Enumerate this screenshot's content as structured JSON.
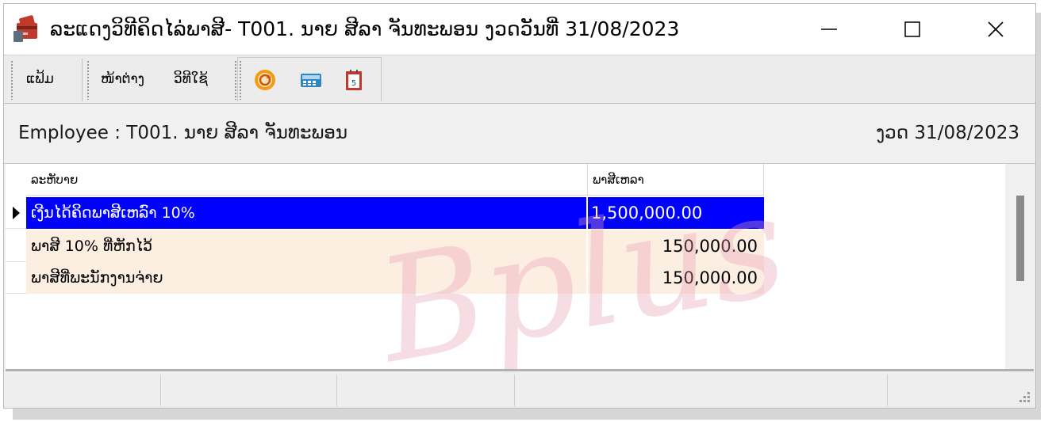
{
  "window": {
    "title": "ລະແດງວິທີຄິດໄລ່ພາສີ- T001. ນາຍ ສີລາ  ຈັນທະພອນ ງວດວັນທີ່ 31/08/2023"
  },
  "toolbar": {
    "items": [
      {
        "label": "ແຟ້ມ"
      },
      {
        "label": "ໜ້າຕ່າງ"
      },
      {
        "label": "ວິທີໃຊ້"
      }
    ],
    "icons": [
      "refresh-icon",
      "calculator-icon",
      "calendar-icon"
    ],
    "calendar_number": "5"
  },
  "header": {
    "employee_label": "Employee : T001. ນາຍ ສີລາ  ຈັນທະພອນ",
    "period_label": "ງວດ 31/08/2023"
  },
  "grid": {
    "columns": [
      "ລະຫັບາຍ",
      "ພາສີເຫລາ"
    ],
    "rows": [
      {
        "description": "ເງີນໄດ້ຄິດພາສີເຫລົາ 10%",
        "amount": "1,500,000.00",
        "selected": true
      },
      {
        "description": "ພາສີ 10% ທີ່ຫັກໄວ້",
        "amount": "150,000.00",
        "selected": false
      },
      {
        "description": "ພາສີທີ່ພະນັກງານຈ່າຍ",
        "amount": "150,000.00",
        "selected": false
      }
    ]
  },
  "watermark": "Bplus",
  "colors": {
    "selection": "#0000ff",
    "row_background": "#fdeee2",
    "watermark": "#e8a0b2"
  }
}
